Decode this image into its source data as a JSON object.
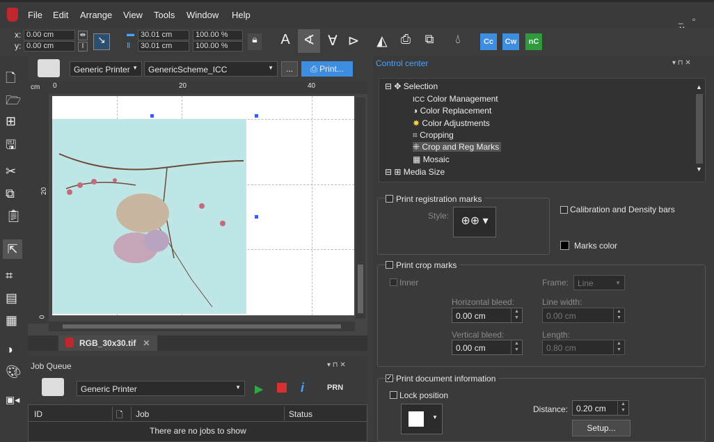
{
  "menu": {
    "items": [
      "File",
      "Edit",
      "Arrange",
      "View",
      "Tools",
      "Window",
      "Help"
    ]
  },
  "toolbar": {
    "x_label": "x:",
    "y_label": "y:",
    "x_value": "0.00 cm",
    "y_value": "0.00 cm",
    "width_value": "30.01 cm",
    "height_value": "30.01 cm",
    "width_pct": "100.00 %",
    "height_pct": "100.00 %",
    "cc_label": "Cc",
    "cw_label": "Cw",
    "nc_label": "nC"
  },
  "printer_bar": {
    "printer": "Generic Printer",
    "scheme": "GenericScheme_ICC",
    "more_label": "...",
    "print_label": "Print..."
  },
  "ruler": {
    "unit": "cm",
    "top_marks": [
      "0",
      "20",
      "40"
    ],
    "left_marks": [
      "0",
      "20"
    ]
  },
  "document_tab": {
    "name": "RGB_30x30.tif"
  },
  "job_queue": {
    "title": "Job Queue",
    "printer": "Generic Printer",
    "prn_label": "PRN",
    "columns": [
      "ID",
      "Job",
      "Status"
    ],
    "empty_text": "There are no jobs to show"
  },
  "control_center": {
    "title": "Control center",
    "tree": {
      "selection": "Selection",
      "items": [
        "Color Management",
        "Color Replacement",
        "Color Adjustments",
        "Cropping",
        "Crop and Reg Marks",
        "Mosaic"
      ],
      "media_size": "Media Size"
    },
    "reg_marks": {
      "label": "Print registration marks",
      "style_label": "Style:",
      "calibration_label": "Calibration and Density bars",
      "marks_color_label": "Marks color"
    },
    "crop_marks": {
      "label": "Print crop marks",
      "inner_label": "Inner",
      "frame_label": "Frame:",
      "frame_value": "Line",
      "hbleed_label": "Horizontal bleed:",
      "hbleed_value": "0.00 cm",
      "line_width_label": "Line width:",
      "line_width_value": "0.00 cm",
      "vbleed_label": "Vertical bleed:",
      "vbleed_value": "0.00 cm",
      "length_label": "Length:",
      "length_value": "0.80 cm"
    },
    "doc_info": {
      "label": "Print document information",
      "lock_label": "Lock position",
      "distance_label": "Distance:",
      "distance_value": "0.20 cm",
      "setup_label": "Setup..."
    }
  },
  "colors": {
    "accent": "#3d8ee0",
    "photo_bg": "#bfe6e6",
    "cc_title": "#4aa3ff"
  }
}
